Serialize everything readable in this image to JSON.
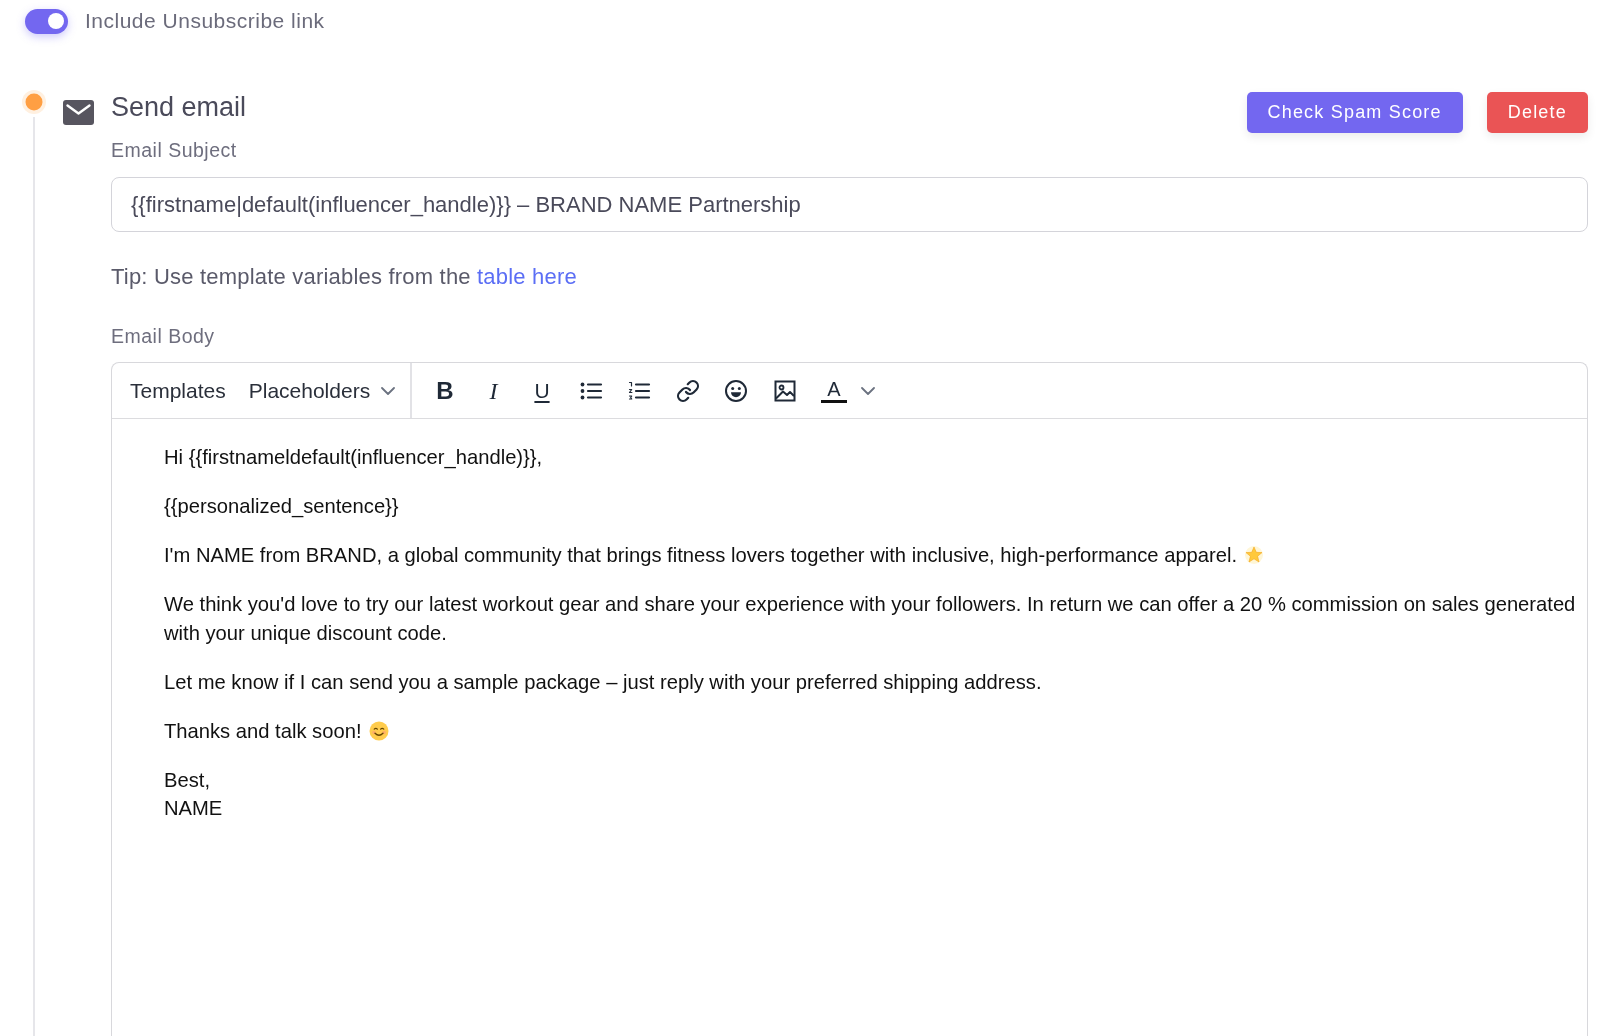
{
  "unsubscribe_toggle": {
    "label": "Include Unsubscribe link",
    "on": true
  },
  "step": {
    "title": "Send email",
    "buttons": [
      {
        "label": "Check Spam Score",
        "kind": "primary"
      },
      {
        "label": "Delete",
        "kind": "danger"
      }
    ],
    "subject": {
      "label": "Email Subject",
      "value": "{{firstname|default(influencer_handle)}} – BRAND NAME Partnership"
    },
    "tip": {
      "text": "Tip: Use template variables from the",
      "link": "table here"
    },
    "body": {
      "label": "Email Body",
      "toolbar": {
        "menus": [
          {
            "label": "Templates",
            "dropdown": false
          },
          {
            "label": "Placeholders",
            "dropdown": true
          }
        ],
        "tools": [
          {
            "kind": "bold",
            "glyph": "B"
          },
          {
            "kind": "italic",
            "glyph": "I"
          },
          {
            "kind": "underline",
            "glyph": "U"
          },
          {
            "kind": "bullets"
          },
          {
            "kind": "numbers"
          },
          {
            "kind": "link"
          },
          {
            "kind": "emoji"
          },
          {
            "kind": "image"
          },
          {
            "kind": "color",
            "glyph": "A",
            "dropdown": true
          }
        ]
      },
      "paragraphs": [
        {
          "kind": "plain",
          "text": "Hi {{firstnameldefault(influencer_handle)}},"
        },
        {
          "kind": "plain",
          "text": "{{personalized_sentence}}"
        },
        {
          "kind": "starred",
          "text": "I'm NAME from BRAND, a global community that brings fitness lovers together with inclusive, high-performance apparel."
        },
        {
          "kind": "plain",
          "text": "We think you'd love to try our latest workout gear and share your experience with your followers. In return we can offer a 20 % commission on sales generated with your unique discount code."
        },
        {
          "kind": "plain",
          "text": "Let me know if I can send you a sample package – just reply with your preferred shipping address."
        },
        {
          "kind": "smiling",
          "text": "Thanks and talk soon!"
        },
        {
          "kind": "plain",
          "text": "Best,\nNAME"
        }
      ]
    }
  }
}
